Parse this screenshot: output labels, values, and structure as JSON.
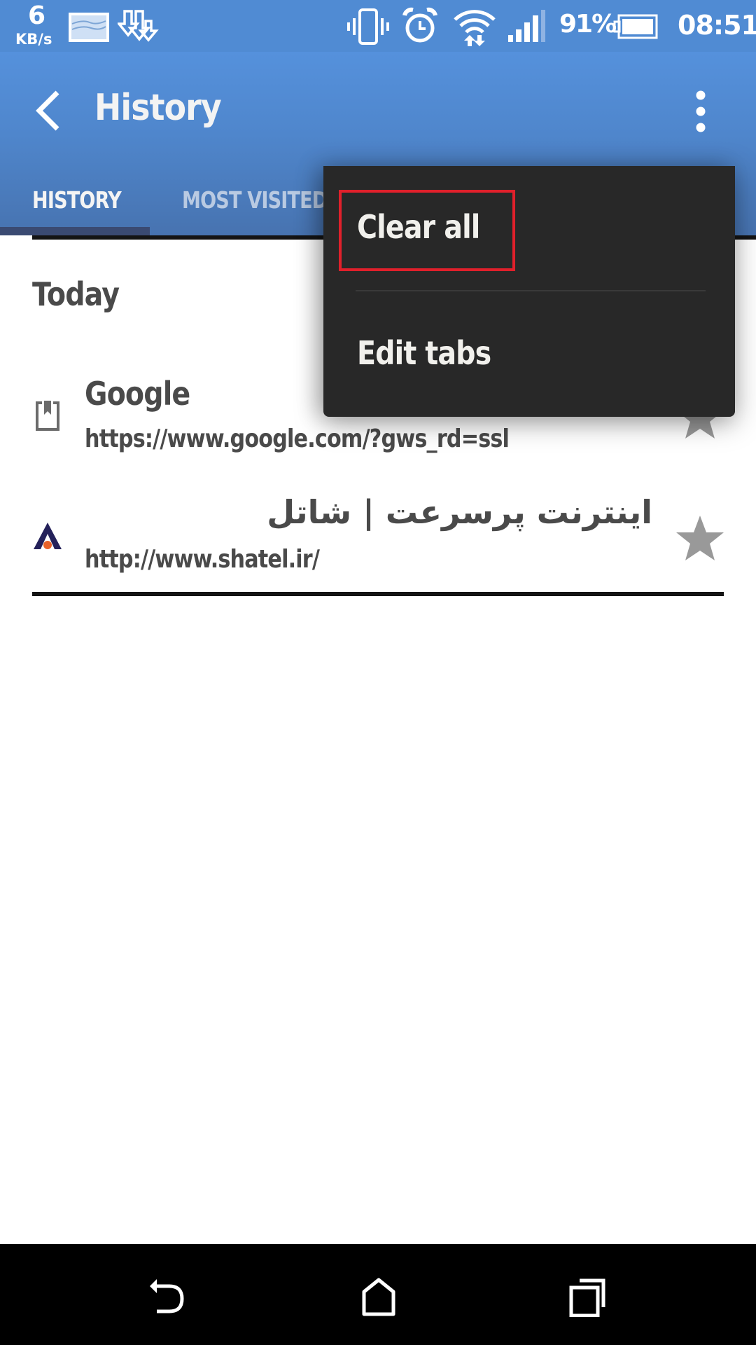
{
  "status_bar": {
    "net_speed_value": "6",
    "net_speed_unit": "KB/s",
    "battery_percent": "91%",
    "time": "08:51",
    "icons": [
      "gallery-notification-icon",
      "download-icon",
      "vibrate-icon",
      "alarm-icon",
      "wifi-icon",
      "signal-icon",
      "battery-icon"
    ]
  },
  "app_bar": {
    "back_icon": "chevron-left-icon",
    "title": "History",
    "overflow_icon": "more-vertical-icon"
  },
  "tabs": [
    {
      "label": "HISTORY",
      "active": true
    },
    {
      "label": "MOST VISITED",
      "active": false
    }
  ],
  "colors": {
    "app_bar": "#508bd3",
    "tab_indicator": "#3a4a72",
    "menu_bg": "#282828",
    "highlight_border": "#e0202b",
    "star": "#999999"
  },
  "content": {
    "section_label": "Today",
    "items": [
      {
        "icon": "bookmark-page-icon",
        "title": "Google",
        "url": "https://www.google.com/?gws_rd=ssl",
        "starred": false
      },
      {
        "icon": "shatel-favicon",
        "title": "اینترنت پرسرعت | شاتل",
        "url": "http://www.shatel.ir/",
        "starred": false
      }
    ]
  },
  "menu": {
    "items": [
      {
        "label": "Clear all",
        "highlighted": true
      },
      {
        "label": "Edit tabs",
        "highlighted": false
      }
    ]
  },
  "nav_bar": {
    "buttons": [
      "back-icon",
      "home-icon",
      "recents-icon"
    ]
  }
}
